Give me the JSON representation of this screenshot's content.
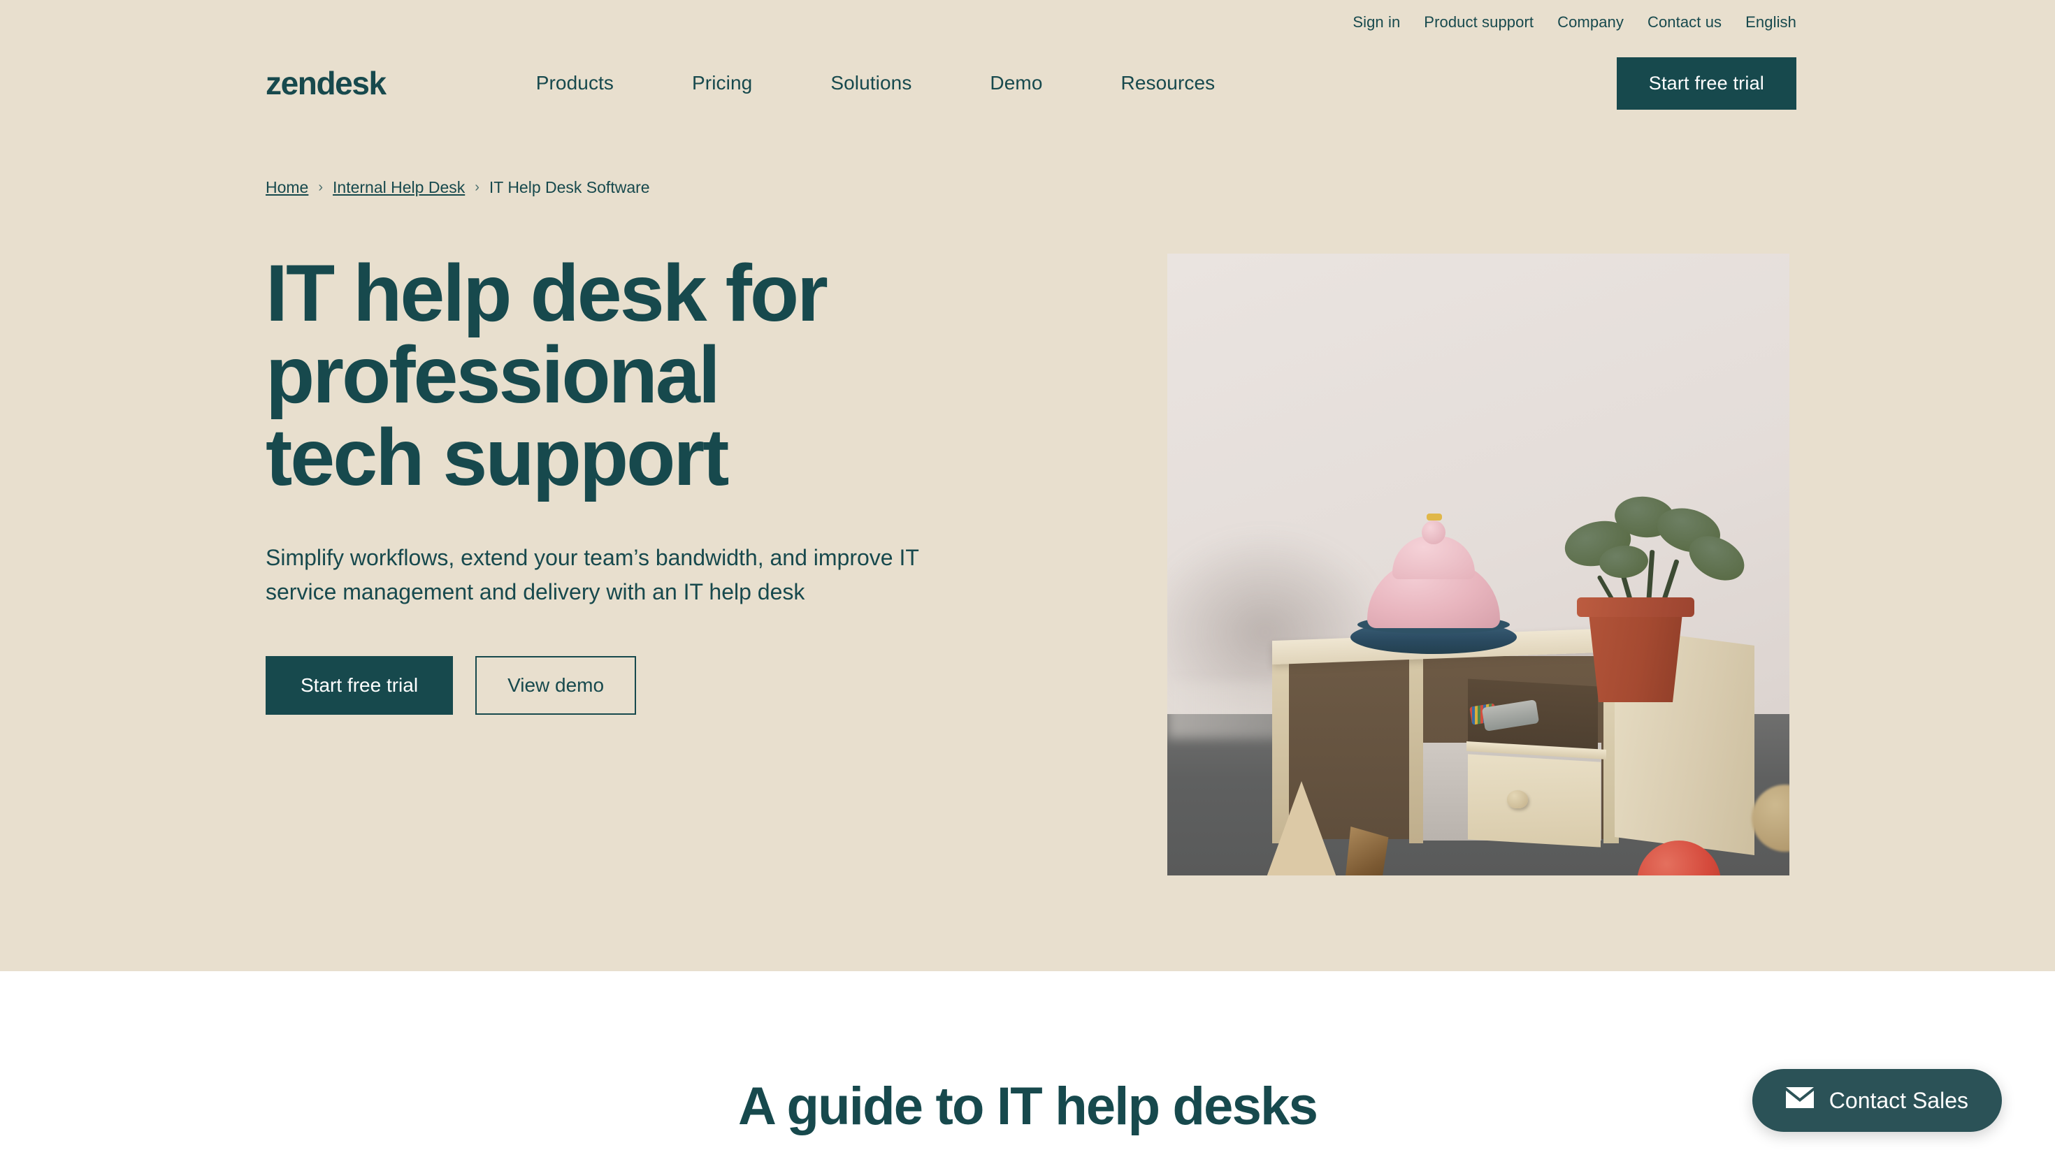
{
  "utility_nav": {
    "items": [
      {
        "label": "Sign in"
      },
      {
        "label": "Product support"
      },
      {
        "label": "Company"
      },
      {
        "label": "Contact us"
      },
      {
        "label": "English"
      }
    ]
  },
  "header": {
    "logo": "zendesk",
    "nav": [
      {
        "label": "Products"
      },
      {
        "label": "Pricing"
      },
      {
        "label": "Solutions"
      },
      {
        "label": "Demo"
      },
      {
        "label": "Resources"
      }
    ],
    "cta_label": "Start free trial"
  },
  "breadcrumb": {
    "home": "Home",
    "separator": "›",
    "parent": "Internal Help Desk",
    "current": "IT Help Desk Software"
  },
  "hero": {
    "title": "IT help desk for\nprofessional\ntech support",
    "subtitle": "Simplify workflows, extend your team’s bandwidth, and improve IT service management and delivery with an IT help desk",
    "primary_button": "Start free trial",
    "secondary_button": "View demo",
    "image_alt": "miniature wooden desk with pink service bell and potted plant"
  },
  "guide": {
    "heading": "A guide to IT help desks"
  },
  "contact_sales": {
    "label": "Contact Sales",
    "icon": "envelope-icon"
  },
  "colors": {
    "hero_background": "#e8dfce",
    "brand_dark": "#17494d",
    "page_background": "#ffffff",
    "fab_background": "#2b5257",
    "bell_pink": "#e8b5be",
    "bell_navy": "#2f5266",
    "pot_terracotta": "#a54a31",
    "ball_red": "#d54a3c"
  }
}
